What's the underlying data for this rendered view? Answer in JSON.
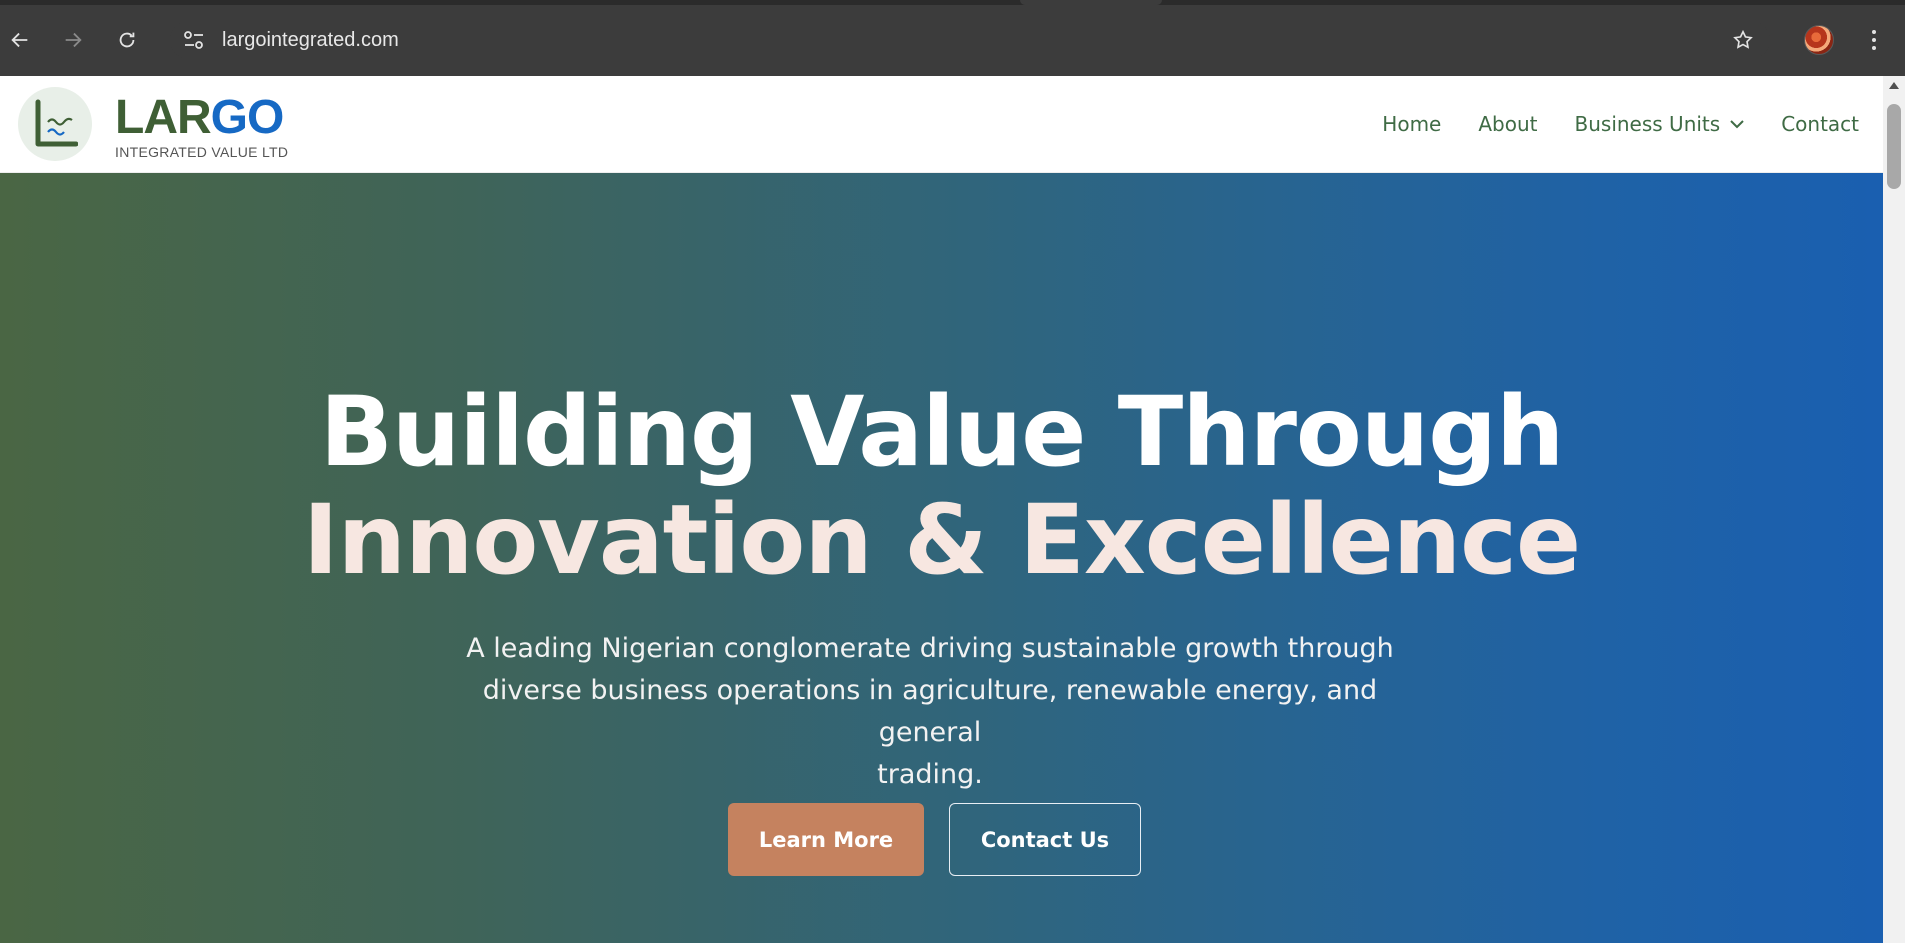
{
  "browser": {
    "url": "largointegrated.com",
    "icons": {
      "back": "back-arrow-icon",
      "forward": "forward-arrow-icon",
      "reload": "reload-icon",
      "site_info": "site-info-icon",
      "bookmark": "star-icon",
      "menu": "more-vert-icon"
    }
  },
  "site": {
    "brand": {
      "name_part1": "LAR",
      "name_part2": "GO",
      "tagline": "INTEGRATED VALUE LTD",
      "colors": {
        "green": "#3f5f35",
        "blue": "#1669c4"
      }
    },
    "nav": {
      "home": "Home",
      "about": "About",
      "business_units": "Business Units",
      "contact": "Contact"
    }
  },
  "hero": {
    "title_line1": "Building Value Through",
    "title_line2": "Innovation & Excellence",
    "subtitle_line1": "A leading Nigerian conglomerate driving sustainable growth through",
    "subtitle_line2": "diverse business operations in agriculture, renewable energy, and general",
    "subtitle_line3": "trading.",
    "primary_cta": "Learn More",
    "secondary_cta": "Contact Us",
    "colors": {
      "gradient_start": "#4a6644",
      "gradient_end": "#1a5fb0",
      "cta": "#c5825f"
    }
  }
}
